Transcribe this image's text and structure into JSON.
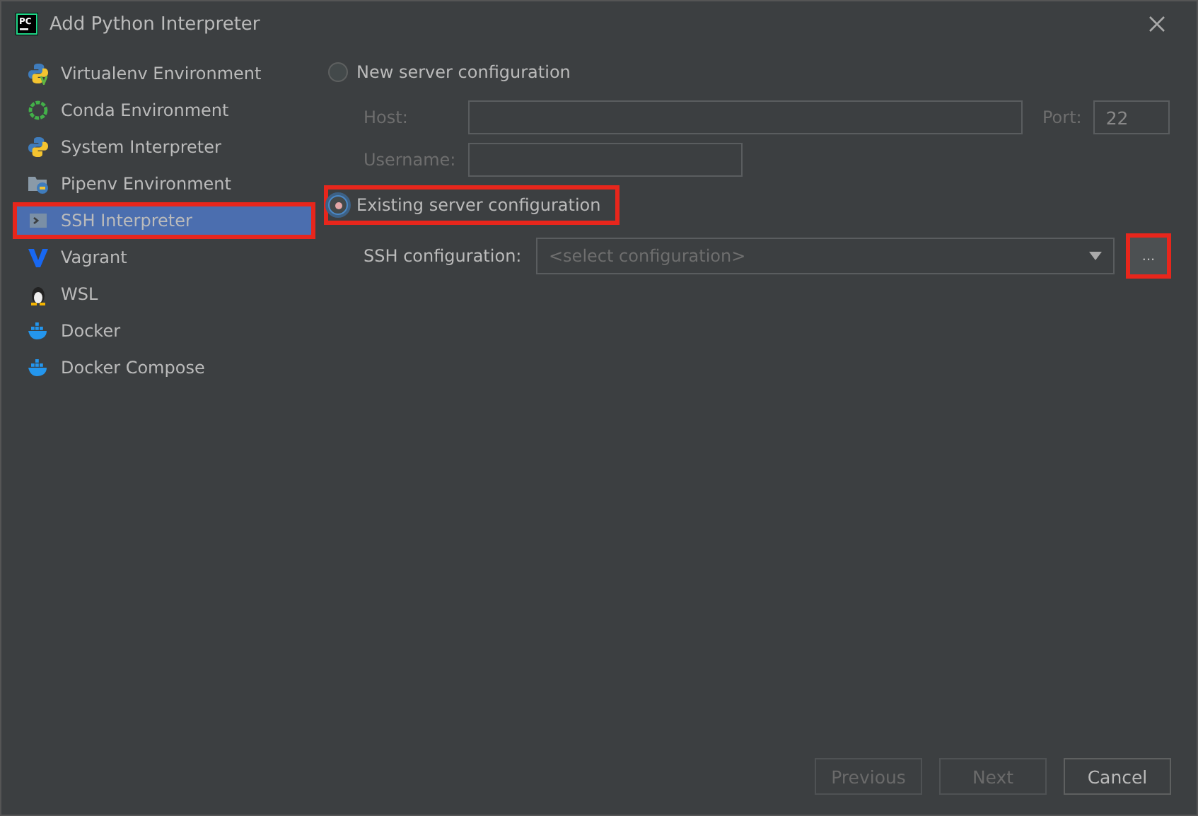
{
  "window": {
    "title": "Add Python Interpreter",
    "logo": "PC"
  },
  "sidebar": {
    "items": [
      {
        "label": "Virtualenv Environment",
        "kind": "virtualenv",
        "selected": false,
        "annotated": false
      },
      {
        "label": "Conda Environment",
        "kind": "conda",
        "selected": false,
        "annotated": false
      },
      {
        "label": "System Interpreter",
        "kind": "python",
        "selected": false,
        "annotated": false
      },
      {
        "label": "Pipenv Environment",
        "kind": "pipenv",
        "selected": false,
        "annotated": false
      },
      {
        "label": "SSH Interpreter",
        "kind": "ssh",
        "selected": true,
        "annotated": true
      },
      {
        "label": "Vagrant",
        "kind": "vagrant",
        "selected": false,
        "annotated": false
      },
      {
        "label": "WSL",
        "kind": "linux",
        "selected": false,
        "annotated": false
      },
      {
        "label": "Docker",
        "kind": "docker",
        "selected": false,
        "annotated": false
      },
      {
        "label": "Docker Compose",
        "kind": "docker",
        "selected": false,
        "annotated": false
      }
    ]
  },
  "new_server": {
    "label": "New server configuration",
    "selected": false,
    "annotated": false,
    "host": {
      "label": "Host:"
    },
    "port": {
      "label": "Port:",
      "value": "22"
    },
    "username": {
      "label": "Username:"
    }
  },
  "existing_server": {
    "label": "Existing server configuration",
    "selected": true,
    "annotated": true,
    "ssh_configuration": {
      "label": "SSH configuration:",
      "placeholder": "<select configuration>"
    },
    "browse_button": {
      "label": "...",
      "annotated": true
    }
  },
  "buttons": [
    {
      "label": "Previous",
      "disabled": true
    },
    {
      "label": "Next",
      "disabled": true
    },
    {
      "label": "Cancel",
      "disabled": false
    }
  ]
}
